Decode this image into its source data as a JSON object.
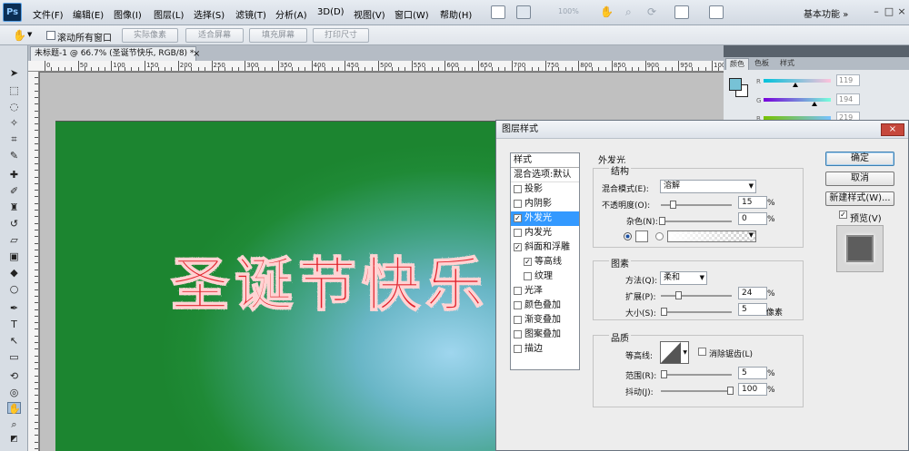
{
  "app": {
    "logo": "Ps",
    "menu": [
      "文件(F)",
      "编辑(E)",
      "图像(I)",
      "图层(L)",
      "选择(S)",
      "滤镜(T)",
      "分析(A)",
      "3D(D)",
      "视图(V)",
      "窗口(W)",
      "帮助(H)"
    ],
    "zoom": "100%",
    "workspace": "基本功能",
    "workspace_arrow": "»",
    "win_min": "–",
    "win_max": "□",
    "win_close": "×"
  },
  "options_bar": {
    "scroll_all_label": "滚动所有窗口",
    "buttons": [
      "实际像素",
      "适合屏幕",
      "填充屏幕",
      "打印尺寸"
    ]
  },
  "document": {
    "tab_title": "未标题-1 @ 66.7% (圣诞节快乐, RGB/8) *",
    "tab_close": "×",
    "ruler_labels": [
      "0",
      "50",
      "100",
      "150",
      "200",
      "250",
      "300",
      "350",
      "400",
      "450",
      "500",
      "550",
      "600",
      "650",
      "700",
      "750",
      "800",
      "850",
      "900",
      "950",
      "100"
    ],
    "canvas_text": "圣诞节快乐"
  },
  "color_panel": {
    "tabs": [
      "颜色",
      "色板",
      "样式"
    ],
    "channels": [
      {
        "name": "R",
        "value": "119",
        "level": 0.47
      },
      {
        "name": "G",
        "value": "194",
        "level": 0.76
      },
      {
        "name": "B",
        "value": "219",
        "level": 0.86
      }
    ],
    "fg_color": "#77c2d6",
    "bg_color": "#ffffff"
  },
  "dialog": {
    "title": "图层样式",
    "close": "×",
    "styles_header": "样式",
    "blend_options": "混合选项:默认",
    "style_items": [
      {
        "label": "投影",
        "checked": false,
        "selected": false
      },
      {
        "label": "内阴影",
        "checked": false,
        "selected": false
      },
      {
        "label": "外发光",
        "checked": true,
        "selected": true
      },
      {
        "label": "内发光",
        "checked": false,
        "selected": false
      },
      {
        "label": "斜面和浮雕",
        "checked": true,
        "selected": false
      },
      {
        "label": "等高线",
        "checked": true,
        "selected": false
      },
      {
        "label": "纹理",
        "checked": false,
        "selected": false
      },
      {
        "label": "光泽",
        "checked": false,
        "selected": false
      },
      {
        "label": "颜色叠加",
        "checked": false,
        "selected": false
      },
      {
        "label": "渐变叠加",
        "checked": false,
        "selected": false
      },
      {
        "label": "图案叠加",
        "checked": false,
        "selected": false
      },
      {
        "label": "描边",
        "checked": false,
        "selected": false
      }
    ],
    "section_title": "外发光",
    "structure": {
      "title": "结构",
      "blend_mode_label": "混合模式(E):",
      "blend_mode_value": "溶解",
      "opacity_label": "不透明度(O):",
      "opacity_value": "15",
      "opacity_unit": "%",
      "noise_label": "杂色(N):",
      "noise_value": "0",
      "noise_unit": "%"
    },
    "elements": {
      "title": "图素",
      "method_label": "方法(Q):",
      "method_value": "柔和",
      "spread_label": "扩展(P):",
      "spread_value": "24",
      "spread_unit": "%",
      "size_label": "大小(S):",
      "size_value": "5",
      "size_unit": "像素"
    },
    "quality": {
      "title": "品质",
      "contour_label": "等高线:",
      "antialias_label": "消除锯齿(L)",
      "range_label": "范围(R):",
      "range_value": "5",
      "range_unit": "%",
      "jitter_label": "抖动(J):",
      "jitter_value": "100",
      "jitter_unit": "%"
    },
    "buttons": {
      "ok": "确定",
      "cancel": "取消",
      "new_style": "新建样式(W)...",
      "preview": "预览(V)"
    }
  }
}
